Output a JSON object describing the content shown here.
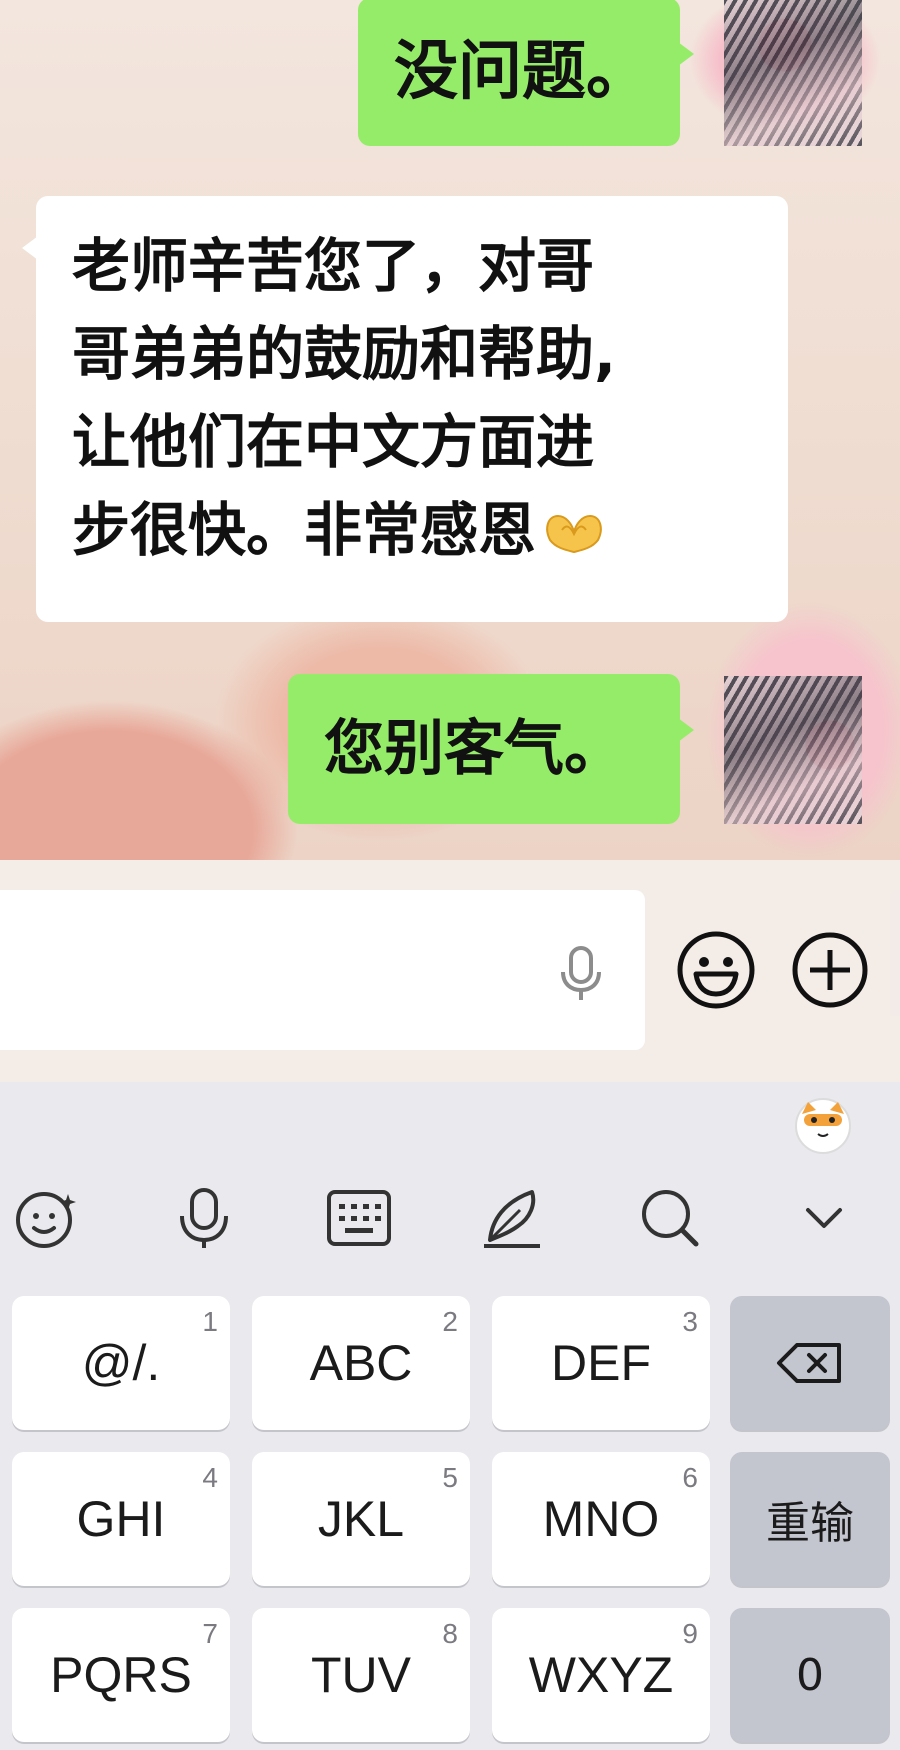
{
  "chat": {
    "messages": [
      {
        "direction": "outgoing",
        "text": "没问题。"
      },
      {
        "direction": "incoming",
        "lines": [
          "老师辛苦您了，对哥",
          "哥弟弟的鼓励和帮助,",
          "让他们在中文方面进",
          "步很快。非常感恩"
        ],
        "emoji": "heart-hands-emoji"
      },
      {
        "direction": "outgoing",
        "text": "您别客气。"
      }
    ]
  },
  "input_bar": {
    "value": "",
    "icons": [
      "microphone-icon",
      "emoji-icon",
      "plus-icon"
    ]
  },
  "keyboard": {
    "toolbar": [
      "emoji-icon",
      "voice-icon",
      "keyboard-icon",
      "handwriting-icon",
      "search-icon",
      "collapse-icon"
    ],
    "keys": [
      {
        "label": "@/.",
        "num": "1"
      },
      {
        "label": "ABC",
        "num": "2"
      },
      {
        "label": "DEF",
        "num": "3"
      },
      {
        "label": "GHI",
        "num": "4"
      },
      {
        "label": "JKL",
        "num": "5"
      },
      {
        "label": "MNO",
        "num": "6"
      },
      {
        "label": "PQRS",
        "num": "7"
      },
      {
        "label": "TUV",
        "num": "8"
      },
      {
        "label": "WXYZ",
        "num": "9"
      }
    ],
    "side_keys": {
      "backspace": "backspace-icon",
      "retype": "重输",
      "zero": "0"
    }
  },
  "colors": {
    "outgoing_bubble": "#95ec69",
    "incoming_bubble": "#ffffff",
    "keyboard_bg": "#e9e9ee",
    "function_key": "#c3c5cf"
  }
}
